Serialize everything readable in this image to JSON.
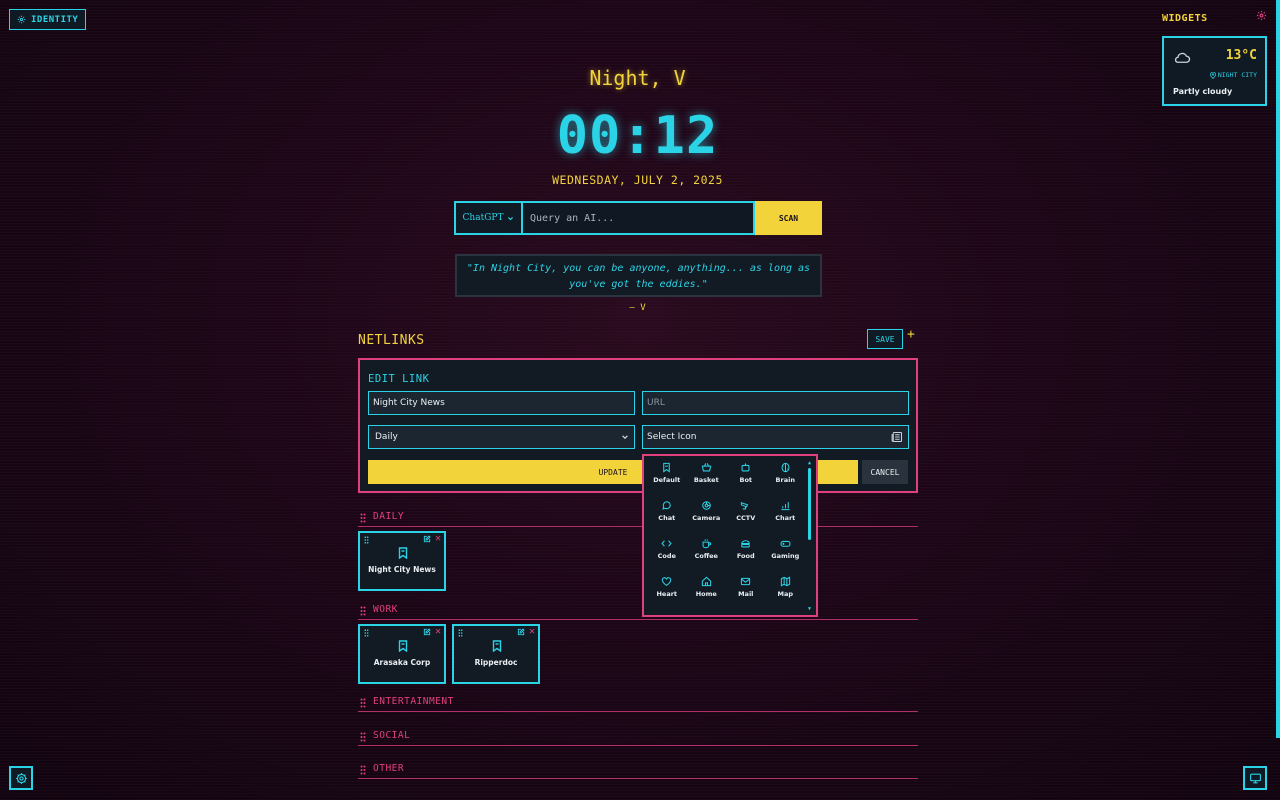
{
  "identity": {
    "label": "IDENTITY",
    "icon": "gear-icon"
  },
  "widgets": {
    "title": "WIDGETS",
    "weather": {
      "temperature": "13°C",
      "location": "NIGHT CITY",
      "condition": "Partly cloudy",
      "icon": "cloud-icon"
    }
  },
  "greeting": "Night, V",
  "clock": "00:12",
  "date": "WEDNESDAY, JULY 2, 2025",
  "search": {
    "engine": "ChatGPT",
    "placeholder": "Query an AI...",
    "button": "SCAN"
  },
  "quote": {
    "text": "\"In Night City, you can be anyone, anything... as long as you've got the eddies.\"",
    "author": "— V"
  },
  "netlinks": {
    "title": "NETLINKS",
    "save_label": "SAVE",
    "add_label": "+",
    "edit": {
      "title": "EDIT LINK",
      "name_value": "Night City News",
      "url_placeholder": "URL",
      "category_value": "Daily",
      "icon_placeholder": "Select Icon",
      "update_label": "UPDATE",
      "cancel_label": "CANCEL"
    },
    "icon_options": [
      "Default",
      "Basket",
      "Bot",
      "Brain",
      "Chat",
      "Camera",
      "CCTV",
      "Chart",
      "Code",
      "Coffee",
      "Food",
      "Gaming",
      "Heart",
      "Home",
      "Mail",
      "Map"
    ],
    "categories": [
      {
        "name": "DAILY",
        "links": [
          {
            "label": "Night City News"
          }
        ]
      },
      {
        "name": "WORK",
        "links": [
          {
            "label": "Arasaka Corp"
          },
          {
            "label": "Ripperdoc"
          }
        ]
      },
      {
        "name": "ENTERTAINMENT",
        "links": []
      },
      {
        "name": "SOCIAL",
        "links": []
      },
      {
        "name": "OTHER",
        "links": []
      }
    ]
  },
  "colors": {
    "cyan": "#2bd3e6",
    "yellow": "#f2d43a",
    "pink": "#e0407e",
    "background": "#1c0617"
  }
}
